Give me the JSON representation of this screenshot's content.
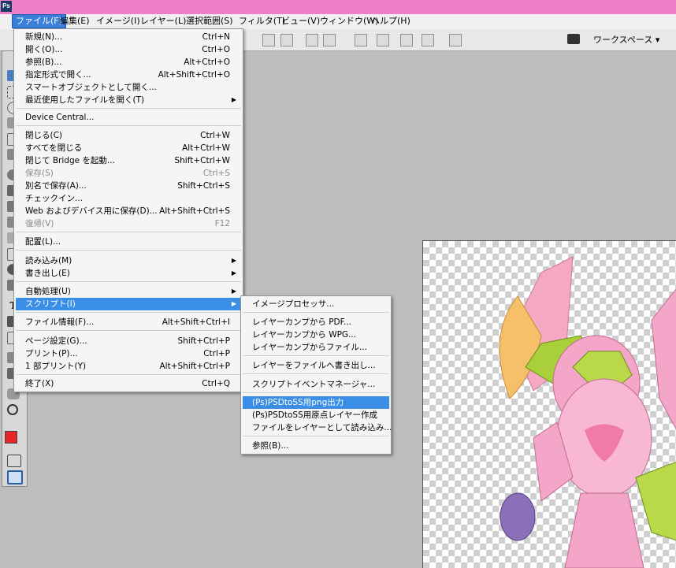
{
  "app": {
    "logo_text": "Ps"
  },
  "menubar": {
    "items": [
      {
        "label": "ファイル(F)",
        "active": true
      },
      {
        "label": "編集(E)"
      },
      {
        "label": "イメージ(I)"
      },
      {
        "label": "レイヤー(L)"
      },
      {
        "label": "選択範囲(S)"
      },
      {
        "label": "フィルタ(T)"
      },
      {
        "label": "ビュー(V)"
      },
      {
        "label": "ウィンドウ(W)"
      },
      {
        "label": "ヘルプ(H)"
      }
    ]
  },
  "options_bar": {
    "workspace_label": "ワークスペース ▾"
  },
  "file_menu": {
    "items": [
      {
        "label": "新規(N)...",
        "shortcut": "Ctrl+N"
      },
      {
        "label": "開く(O)...",
        "shortcut": "Ctrl+O"
      },
      {
        "label": "参照(B)...",
        "shortcut": "Alt+Ctrl+O"
      },
      {
        "label": "指定形式で開く...",
        "shortcut": "Alt+Shift+Ctrl+O"
      },
      {
        "label": "スマートオブジェクトとして開く...",
        "shortcut": ""
      },
      {
        "label": "最近使用したファイルを開く(T)",
        "shortcut": "",
        "submenu": true
      },
      {
        "label": "Device Central...",
        "shortcut": ""
      },
      {
        "label": "閉じる(C)",
        "shortcut": "Ctrl+W"
      },
      {
        "label": "すべてを閉じる",
        "shortcut": "Alt+Ctrl+W"
      },
      {
        "label": "閉じて Bridge を起動...",
        "shortcut": "Shift+Ctrl+W"
      },
      {
        "label": "保存(S)",
        "shortcut": "Ctrl+S",
        "disabled": true
      },
      {
        "label": "別名で保存(A)...",
        "shortcut": "Shift+Ctrl+S"
      },
      {
        "label": "チェックイン...",
        "shortcut": ""
      },
      {
        "label": "Web およびデバイス用に保存(D)...",
        "shortcut": "Alt+Shift+Ctrl+S"
      },
      {
        "label": "復帰(V)",
        "shortcut": "F12",
        "disabled": true
      },
      {
        "label": "配置(L)...",
        "shortcut": ""
      },
      {
        "label": "読み込み(M)",
        "shortcut": "",
        "submenu": true
      },
      {
        "label": "書き出し(E)",
        "shortcut": "",
        "submenu": true
      },
      {
        "label": "自動処理(U)",
        "shortcut": "",
        "submenu": true
      },
      {
        "label": "スクリプト(I)",
        "shortcut": "",
        "submenu": true,
        "highlighted": true
      },
      {
        "label": "ファイル情報(F)...",
        "shortcut": "Alt+Shift+Ctrl+I"
      },
      {
        "label": "ページ設定(G)...",
        "shortcut": "Shift+Ctrl+P"
      },
      {
        "label": "プリント(P)...",
        "shortcut": "Ctrl+P"
      },
      {
        "label": "1 部プリント(Y)",
        "shortcut": "Alt+Shift+Ctrl+P"
      },
      {
        "label": "終了(X)",
        "shortcut": "Ctrl+Q"
      }
    ]
  },
  "script_menu": {
    "items": [
      {
        "label": "イメージプロセッサ..."
      },
      {
        "label": "レイヤーカンプから PDF..."
      },
      {
        "label": "レイヤーカンプから WPG..."
      },
      {
        "label": "レイヤーカンプからファイル..."
      },
      {
        "label": "レイヤーをファイルへ書き出し..."
      },
      {
        "label": "スクリプトイベントマネージャ..."
      },
      {
        "label": "(Ps)PSDtoSS用png出力",
        "highlighted": true
      },
      {
        "label": "(Ps)PSDtoSS用原点レイヤー作成"
      },
      {
        "label": "ファイルをレイヤーとして読み込み..."
      },
      {
        "label": "参照(B)..."
      }
    ]
  },
  "colors": {
    "titlebar": "#f07ec8",
    "menu_highlight": "#3b8ee6",
    "foreground_color": "#e8262a",
    "background_color": "#ffffff"
  }
}
